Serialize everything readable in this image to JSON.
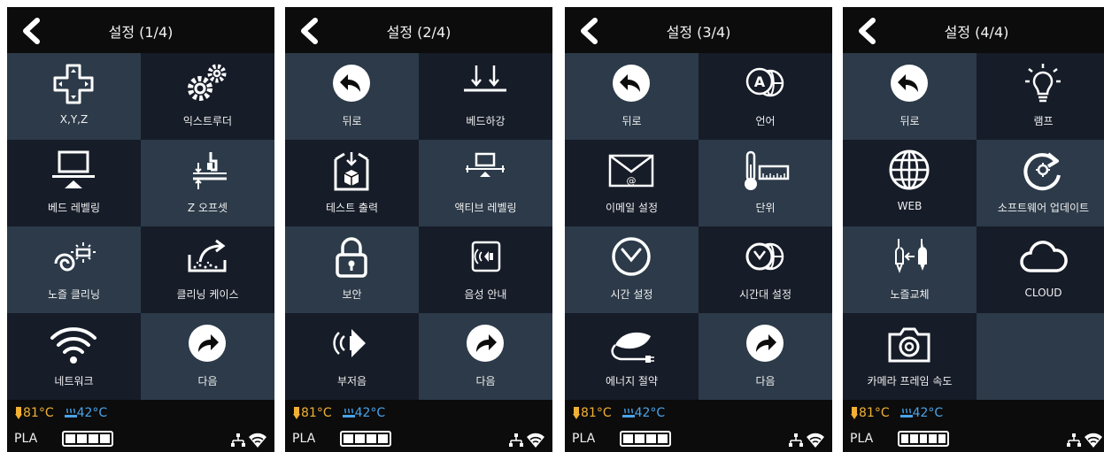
{
  "panels": [
    {
      "title": "설정 (1/4)",
      "cells": [
        {
          "label": "X,Y,Z",
          "icon": "dpad-icon"
        },
        {
          "label": "익스트루더",
          "icon": "gears-icon"
        },
        {
          "label": "베드 레벨링",
          "icon": "bed-leveling-icon"
        },
        {
          "label": "Z 오프셋",
          "icon": "z-offset-icon"
        },
        {
          "label": "노즐 클리닝",
          "icon": "nozzle-cleaning-icon"
        },
        {
          "label": "클리닝 케이스",
          "icon": "cleaning-case-icon"
        },
        {
          "label": "네트워크",
          "icon": "wifi-icon"
        },
        {
          "label": "다음",
          "icon": "next-arrow-icon"
        }
      ],
      "level": 4
    },
    {
      "title": "설정 (2/4)",
      "cells": [
        {
          "label": "뒤로",
          "icon": "back-arrow-icon"
        },
        {
          "label": "베드하강",
          "icon": "bed-lower-icon"
        },
        {
          "label": "테스트 출력",
          "icon": "test-print-icon"
        },
        {
          "label": "액티브 레벨링",
          "icon": "active-leveling-icon"
        },
        {
          "label": "보안",
          "icon": "lock-icon"
        },
        {
          "label": "음성 안내",
          "icon": "voice-guide-icon"
        },
        {
          "label": "부저음",
          "icon": "buzzer-icon"
        },
        {
          "label": "다음",
          "icon": "next-arrow-icon"
        }
      ],
      "level": 4
    },
    {
      "title": "설정 (3/4)",
      "cells": [
        {
          "label": "뒤로",
          "icon": "back-arrow-icon"
        },
        {
          "label": "언어",
          "icon": "language-icon"
        },
        {
          "label": "이메일 설정",
          "icon": "email-icon"
        },
        {
          "label": "단위",
          "icon": "units-icon"
        },
        {
          "label": "시간 설정",
          "icon": "clock-icon"
        },
        {
          "label": "시간대 설정",
          "icon": "timezone-icon"
        },
        {
          "label": "에너지 절약",
          "icon": "energy-saving-icon"
        },
        {
          "label": "다음",
          "icon": "next-arrow-icon"
        }
      ],
      "level": 4
    },
    {
      "title": "설정 (4/4)",
      "cells": [
        {
          "label": "뒤로",
          "icon": "back-arrow-icon"
        },
        {
          "label": "램프",
          "icon": "lamp-icon"
        },
        {
          "label": "WEB",
          "icon": "globe-icon"
        },
        {
          "label": "소프트웨어 업데이트",
          "icon": "software-update-icon"
        },
        {
          "label": "노즐교체",
          "icon": "nozzle-change-icon"
        },
        {
          "label": "CLOUD",
          "icon": "cloud-icon"
        },
        {
          "label": "카메라 프레임 속도",
          "icon": "camera-icon"
        },
        {
          "label": "",
          "icon": ""
        }
      ],
      "level": 5
    }
  ],
  "status": {
    "nozzle_temp": "81°C",
    "bed_temp": "42°C",
    "material": "PLA",
    "level_max": 5
  },
  "colors": {
    "nozzle": "#f2b134",
    "bed": "#4aa3e8",
    "cell_light": "#2c3a49",
    "cell_dark": "#161c28"
  }
}
